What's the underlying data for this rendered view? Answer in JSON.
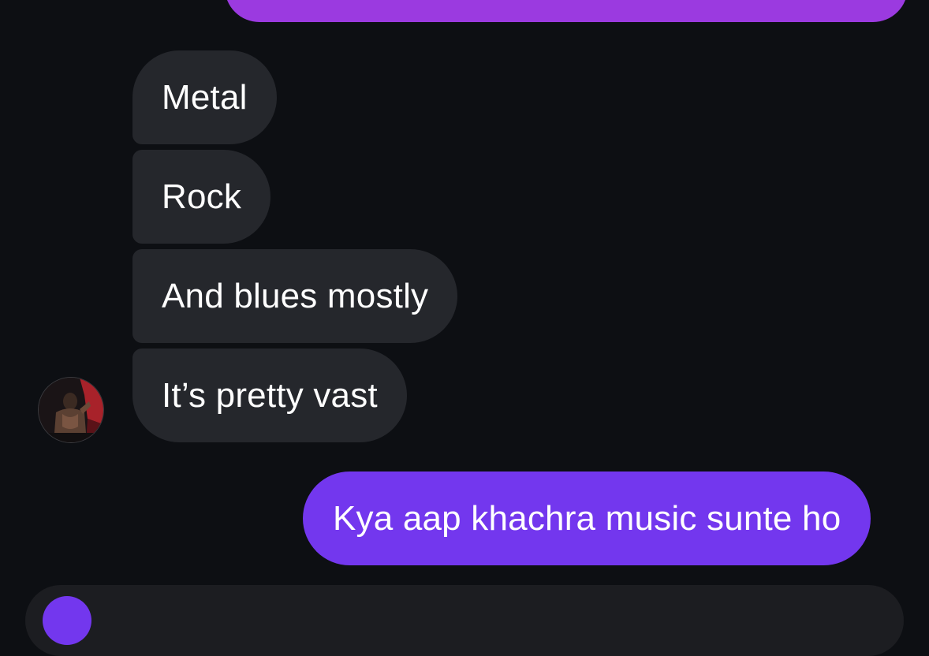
{
  "chat": {
    "messages": [
      {
        "direction": "incoming",
        "text": "Metal"
      },
      {
        "direction": "incoming",
        "text": "Rock"
      },
      {
        "direction": "incoming",
        "text": "And blues mostly"
      },
      {
        "direction": "incoming",
        "text": "It’s pretty vast"
      },
      {
        "direction": "outgoing",
        "text": "Kya aap khachra music sunte ho"
      }
    ],
    "avatar_icon": "user-avatar-photo",
    "colors": {
      "background": "#0d0f13",
      "incoming_bubble": "#25272c",
      "outgoing_bubble": "#7337ee",
      "previous_outgoing_bubble": "#9b3ae0",
      "text": "#ffffff"
    }
  },
  "composer": {
    "icon": "camera-icon"
  }
}
